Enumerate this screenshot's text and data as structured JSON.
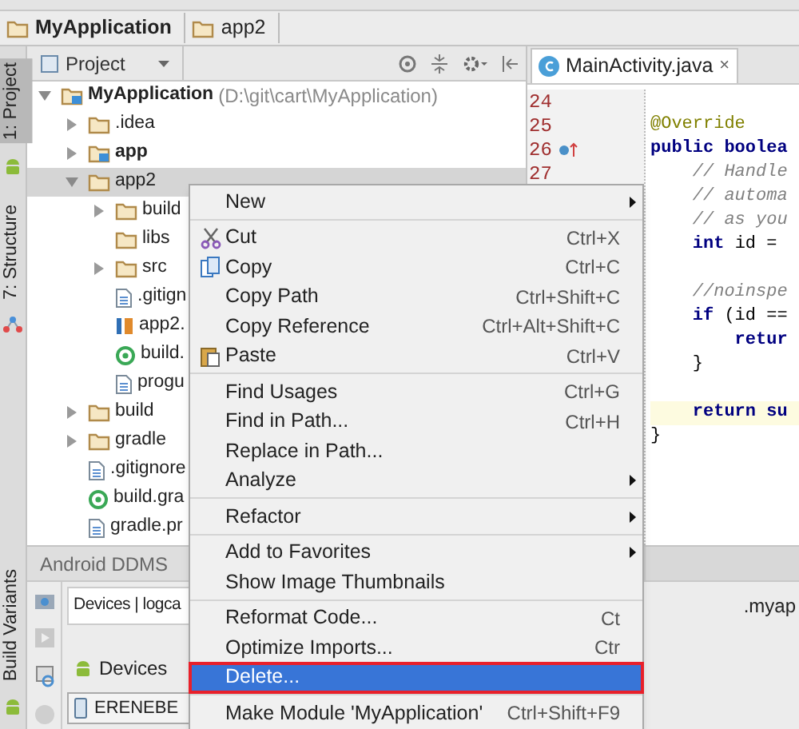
{
  "breadcrumb": [
    {
      "label": "MyApplication",
      "bold": true
    },
    {
      "label": "app2",
      "bold": false
    }
  ],
  "left_tabs": [
    {
      "label": "1: Project",
      "selected": true,
      "kind": "android"
    },
    {
      "label": "7: Structure",
      "selected": false,
      "kind": "structure"
    }
  ],
  "bottom_left_tabs": [
    {
      "label": "Build Variants",
      "selected": false,
      "kind": "android"
    }
  ],
  "project_panel": {
    "title": "Project",
    "tree": [
      {
        "label": "MyApplication",
        "path": "(D:\\git\\cart\\MyApplication)",
        "kind": "module",
        "bold": true,
        "expanded": true,
        "selected": false,
        "children": [
          {
            "label": ".idea",
            "kind": "folder",
            "bold": false,
            "expanded": false,
            "selected": false
          },
          {
            "label": "app",
            "kind": "module",
            "bold": true,
            "expanded": false,
            "selected": false
          },
          {
            "label": "app2",
            "kind": "folder",
            "bold": false,
            "expanded": true,
            "selected": true,
            "children": [
              {
                "label": "build",
                "kind": "folder",
                "bold": false,
                "expanded": false,
                "selected": false
              },
              {
                "label": "libs",
                "kind": "folder",
                "bold": false,
                "selected": false
              },
              {
                "label": "src",
                "kind": "folder",
                "bold": false,
                "expanded": false,
                "selected": false
              },
              {
                "label": ".gitign",
                "kind": "file",
                "bold": false,
                "selected": false
              },
              {
                "label": "app2.",
                "kind": "iml",
                "bold": false,
                "selected": false
              },
              {
                "label": "build.",
                "kind": "gradle",
                "bold": false,
                "selected": false
              },
              {
                "label": "progu",
                "kind": "file",
                "bold": false,
                "selected": false
              }
            ]
          },
          {
            "label": "build",
            "kind": "folder",
            "bold": false,
            "expanded": false,
            "selected": false
          },
          {
            "label": "gradle",
            "kind": "folder",
            "bold": false,
            "expanded": false,
            "selected": false
          },
          {
            "label": ".gitignore",
            "kind": "file",
            "bold": false,
            "selected": false
          },
          {
            "label": "build.gra",
            "kind": "gradle",
            "bold": false,
            "selected": false
          },
          {
            "label": "gradle.pr",
            "kind": "file",
            "bold": false,
            "selected": false
          }
        ]
      }
    ]
  },
  "editor": {
    "tab": {
      "label": "MainActivity.java",
      "close": "×"
    },
    "line_numbers": [
      "24",
      "25",
      "26",
      "27"
    ],
    "lines": [
      {
        "kind": "blank",
        "highlighted": false
      },
      {
        "kind": "annotation",
        "text": "@Override",
        "highlighted": false
      },
      {
        "kind": "keyword",
        "text": "public boolea",
        "highlighted": false
      },
      {
        "kind": "comment",
        "text": "    // Handle",
        "highlighted": false
      },
      {
        "kind": "comment",
        "text": "    // automa",
        "highlighted": false
      },
      {
        "kind": "comment",
        "text": "    // as you",
        "highlighted": false
      },
      {
        "kind": "code",
        "text": "    **int** id =",
        "highlighted": false
      },
      {
        "kind": "blank",
        "highlighted": false
      },
      {
        "kind": "comment",
        "text": "    //noinspe",
        "highlighted": false
      },
      {
        "kind": "code",
        "text": "    **if** (id ==",
        "highlighted": false
      },
      {
        "kind": "keyword",
        "text": "        retur",
        "highlighted": false
      },
      {
        "kind": "code",
        "text": "    }",
        "highlighted": false
      },
      {
        "kind": "blank",
        "highlighted": false
      },
      {
        "kind": "keyword",
        "text": "    return su",
        "highlighted": true
      },
      {
        "kind": "code",
        "text": "}",
        "highlighted": false
      }
    ]
  },
  "ddms": {
    "title": "Android DDMS",
    "tab": "Devices | logca",
    "devices_label": "Devices",
    "device": "ERENEBE",
    "side_text": ".myap"
  },
  "context_menu": [
    {
      "kind": "item",
      "label": "New",
      "submenu": true,
      "selected": false
    },
    {
      "kind": "separator"
    },
    {
      "kind": "item",
      "label": "Cut",
      "shortcut": "Ctrl+X",
      "submenu": false,
      "selected": false
    },
    {
      "kind": "item",
      "label": "Copy",
      "shortcut": "Ctrl+C",
      "submenu": false,
      "selected": false
    },
    {
      "kind": "item",
      "label": "Copy Path",
      "shortcut": "Ctrl+Shift+C",
      "submenu": false,
      "selected": false
    },
    {
      "kind": "item",
      "label": "Copy Reference",
      "shortcut": "Ctrl+Alt+Shift+C",
      "submenu": false,
      "selected": false
    },
    {
      "kind": "item",
      "label": "Paste",
      "shortcut": "Ctrl+V",
      "submenu": false,
      "selected": false
    },
    {
      "kind": "separator"
    },
    {
      "kind": "item",
      "label": "Find Usages",
      "shortcut": "Ctrl+G",
      "submenu": false,
      "selected": false
    },
    {
      "kind": "item",
      "label": "Find in Path...",
      "shortcut": "Ctrl+H",
      "submenu": false,
      "selected": false
    },
    {
      "kind": "item",
      "label": "Replace in Path...",
      "submenu": false,
      "selected": false
    },
    {
      "kind": "item",
      "label": "Analyze",
      "submenu": true,
      "selected": false
    },
    {
      "kind": "separator"
    },
    {
      "kind": "item",
      "label": "Refactor",
      "submenu": true,
      "selected": false
    },
    {
      "kind": "separator"
    },
    {
      "kind": "item",
      "label": "Add to Favorites",
      "submenu": true,
      "selected": false
    },
    {
      "kind": "item",
      "label": "Show Image Thumbnails",
      "submenu": false,
      "selected": false
    },
    {
      "kind": "separator"
    },
    {
      "kind": "item",
      "label": "Reformat Code...",
      "shortcut": "Ct",
      "submenu": false,
      "selected": false
    },
    {
      "kind": "item",
      "label": "Optimize Imports...",
      "shortcut": "Ctr",
      "submenu": false,
      "selected": false
    },
    {
      "kind": "item",
      "label": "Delete...",
      "submenu": false,
      "selected": true
    },
    {
      "kind": "separator"
    },
    {
      "kind": "item",
      "label": "Make Module 'MyApplication'",
      "shortcut": "Ctrl+Shift+F9",
      "submenu": false,
      "selected": false
    }
  ]
}
